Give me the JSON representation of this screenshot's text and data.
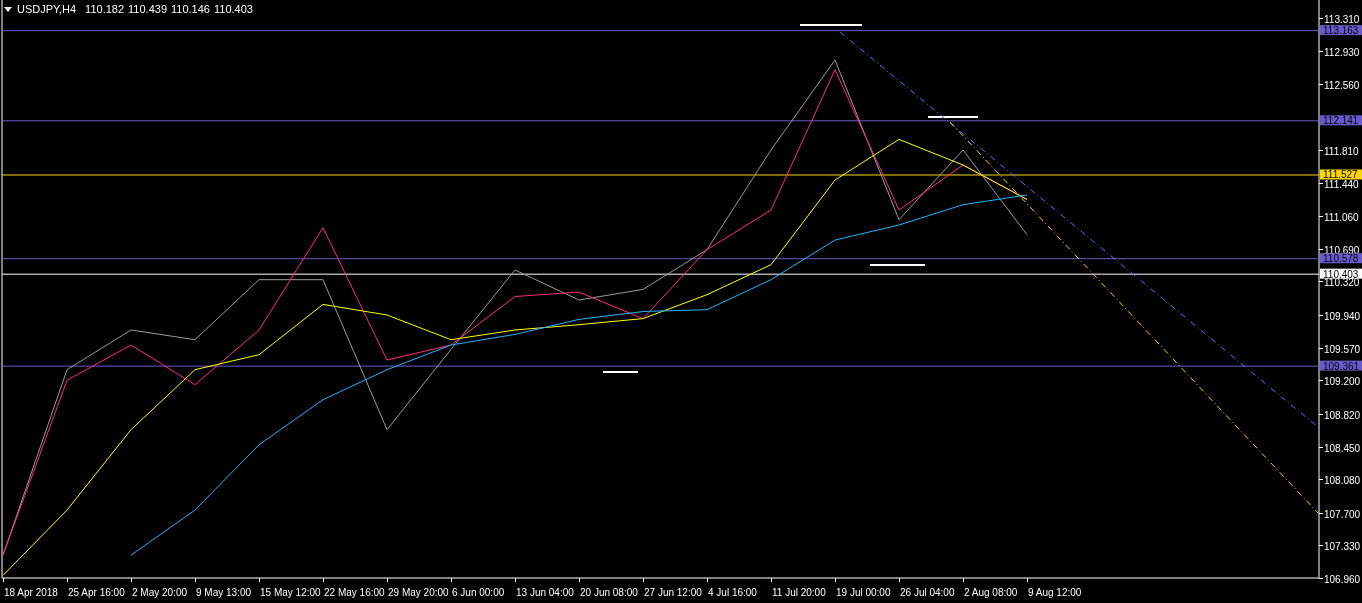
{
  "header": {
    "symbol": "USDJPY,H4",
    "quotes": [
      "110.182",
      "110.439",
      "110.146",
      "110.403"
    ]
  },
  "chart": {
    "chart_data": {
      "type": "line",
      "categories": [
        "18 Apr 2018",
        "25 Apr 16:00",
        "2 May 20:00",
        "9 May 13:00",
        "15 May 12:00",
        "22 May 16:00",
        "29 May 20:00",
        "6 Jun 00:00",
        "13 Jun 04:00",
        "20 Jun 08:00",
        "27 Jun 12:00",
        "4 Jul 16:00",
        "11 Jul 20:00",
        "19 Jul 00:00",
        "26 Jul 04:00",
        "2 Aug 08:00",
        "9 Aug 12:00"
      ],
      "series": [
        {
          "color": "#9a9a9a",
          "values": [
            107.22,
            109.32,
            109.77,
            109.66,
            110.34,
            110.34,
            108.64,
            109.55,
            110.45,
            110.11,
            110.23,
            110.68,
            111.81,
            112.83,
            111.02,
            111.81,
            110.85
          ]
        },
        {
          "color": "#ff2a7f",
          "values": [
            107.22,
            109.2,
            109.6,
            109.15,
            109.77,
            110.93,
            109.43,
            109.6,
            110.15,
            110.2,
            109.9,
            110.68,
            111.13,
            112.72,
            111.13,
            111.64,
            111.25
          ]
        },
        {
          "color": "#ffff00",
          "values": [
            106.99,
            107.73,
            108.64,
            109.32,
            109.49,
            110.06,
            109.94,
            109.66,
            109.77,
            109.83,
            109.9,
            110.17,
            110.51,
            111.47,
            111.93,
            111.64,
            111.25
          ]
        },
        {
          "color": "#1eb4ff",
          "values": [
            null,
            null,
            107.22,
            107.73,
            108.47,
            108.98,
            109.32,
            109.6,
            109.72,
            109.89,
            109.98,
            110.0,
            110.34,
            110.79,
            110.96,
            111.19,
            111.3
          ]
        }
      ],
      "ylim": [
        106.96,
        113.51
      ],
      "yticks": [
        {
          "value": 113.31,
          "label": "113.310"
        },
        {
          "value": 112.93,
          "label": "112.930"
        },
        {
          "value": 112.56,
          "label": "112.560"
        },
        {
          "value": 111.81,
          "label": "111.810"
        },
        {
          "value": 111.44,
          "label": "111.440"
        },
        {
          "value": 111.06,
          "label": "111.060"
        },
        {
          "value": 110.69,
          "label": "110.690"
        },
        {
          "value": 110.32,
          "label": "110.320"
        },
        {
          "value": 109.94,
          "label": "109.940"
        },
        {
          "value": 109.57,
          "label": "109.570"
        },
        {
          "value": 109.2,
          "label": "109.200"
        },
        {
          "value": 108.82,
          "label": "108.820"
        },
        {
          "value": 108.45,
          "label": "108.450"
        },
        {
          "value": 108.08,
          "label": "108.080"
        },
        {
          "value": 107.7,
          "label": "107.700"
        },
        {
          "value": 107.33,
          "label": "107.330"
        },
        {
          "value": 106.96,
          "label": "106.960"
        }
      ],
      "ref_lines": [
        {
          "axis": "y",
          "value": 113.163,
          "label": "113.163",
          "color": "#6a5acd"
        },
        {
          "axis": "y",
          "value": 112.141,
          "label": "112.141",
          "color": "#6a5acd"
        },
        {
          "axis": "y",
          "value": 111.527,
          "label": "111.527",
          "color": "#ffd700"
        },
        {
          "axis": "y",
          "value": 110.578,
          "label": "110.578",
          "color": "#6a5acd"
        },
        {
          "axis": "y",
          "value": 110.403,
          "label": "110.403",
          "color": "#ffffff"
        },
        {
          "axis": "y",
          "value": 109.361,
          "label": "109.361",
          "color": "#6a5acd"
        }
      ]
    }
  }
}
